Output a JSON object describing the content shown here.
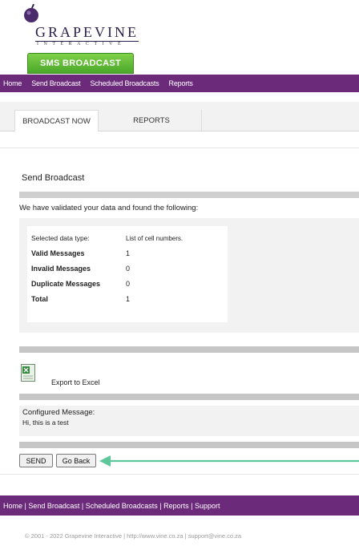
{
  "brand": {
    "logo_text": "GRAPEVINE",
    "logo_sub": "INTERACTIVE",
    "product_tab": "SMS BROADCAST"
  },
  "top_nav": [
    "Home",
    "Send Broadcast",
    "Scheduled Broadcasts",
    "Reports"
  ],
  "tabs": [
    {
      "label": "BROADCAST NOW",
      "active": true
    },
    {
      "label": "REPORTS",
      "active": false
    }
  ],
  "page": {
    "title": "Send Broadcast",
    "intro": "We have validated your data and found the following:"
  },
  "summary": {
    "data_type_label": "Selected data type:",
    "data_type_value": "List of cell numbers.",
    "rows": [
      {
        "label": "Valid Messages",
        "value": "1"
      },
      {
        "label": "Invalid Messages",
        "value": "0"
      },
      {
        "label": "Duplicate Messages",
        "value": "0"
      },
      {
        "label": "Total",
        "value": "1"
      }
    ]
  },
  "export": {
    "label": "Export to Excel",
    "icon": "excel-icon"
  },
  "configured": {
    "label": "Configured Message:",
    "message": "Hi, this is a test"
  },
  "buttons": {
    "send": "SEND",
    "back": "Go Back"
  },
  "footer": {
    "nav": "Home | Send Broadcast | Scheduled Broadcasts | Reports | Support",
    "copyright": "© 2001 - 2022 Grapevine Interactive | http://www.vine.co.za | support@vine.co.za"
  },
  "colors": {
    "nav_purple": "#6b2a7a",
    "brand_green": "#5bb832",
    "arrow_green": "#5cc79a"
  }
}
